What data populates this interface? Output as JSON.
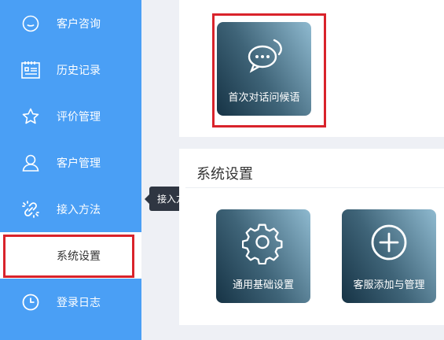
{
  "sidebar": {
    "items": [
      {
        "label": "客户咨询",
        "icon": "smile-icon"
      },
      {
        "label": "历史记录",
        "icon": "calendar-list-icon"
      },
      {
        "label": "评价管理",
        "icon": "star-icon"
      },
      {
        "label": "客户管理",
        "icon": "user-icon"
      },
      {
        "label": "接入方法",
        "icon": "link-icon"
      },
      {
        "label": "系统设置",
        "icon": "none"
      },
      {
        "label": "登录日志",
        "icon": "clock-icon"
      }
    ],
    "active_index": 5
  },
  "tooltip": {
    "text": "接入方法"
  },
  "top_panel": {
    "card": {
      "label": "首次对话问候语",
      "icon": "chat-bubble-icon"
    }
  },
  "settings_panel": {
    "title": "系统设置",
    "cards": [
      {
        "label": "通用基础设置",
        "icon": "gear-icon"
      },
      {
        "label": "客服添加与管理",
        "icon": "plus-circle-icon"
      }
    ]
  },
  "colors": {
    "sidebar_bg": "#4a9ff5",
    "highlight": "#d9232b",
    "tooltip_bg": "#2f3642"
  }
}
